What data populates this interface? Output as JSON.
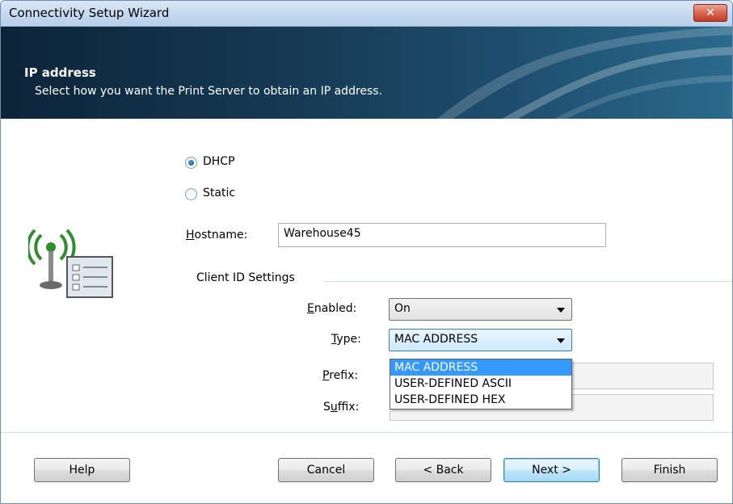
{
  "window": {
    "title": "Connectivity Setup Wizard",
    "close_glyph": "✕"
  },
  "banner": {
    "title": "IP address",
    "subtitle": "Select how you want the Print Server to obtain an IP address."
  },
  "form": {
    "radio_dhcp": {
      "label": "DHCP",
      "checked": true
    },
    "radio_static": {
      "label": "Static",
      "checked": false
    },
    "hostname": {
      "label_prefix": "H",
      "label_rest": "ostname:",
      "value": "Warehouse45"
    },
    "client_id_group": "Client ID Settings",
    "enabled": {
      "label_prefix": "E",
      "label_rest": "nabled:",
      "value": "On"
    },
    "type": {
      "label_prefix": "T",
      "label_rest": "ype:",
      "value": "MAC ADDRESS",
      "options": [
        "MAC ADDRESS",
        "USER-DEFINED ASCII",
        "USER-DEFINED HEX"
      ]
    },
    "prefix": {
      "label_prefix": "P",
      "label_rest": "refix:",
      "value": ""
    },
    "suffix": {
      "label_prefix": "S",
      "label_mid": "u",
      "label_rest": "ffix:",
      "value": ""
    }
  },
  "buttons": {
    "help": "Help",
    "cancel": "Cancel",
    "back": "< Back",
    "next": "Next >",
    "finish": "Finish"
  },
  "icons": {
    "wizard_icon": "wireless-network-settings-icon",
    "close": "close-icon",
    "dropdown_arrow": "chevron-down-icon"
  },
  "colors": {
    "banner_dark": "#0c2438",
    "selection": "#3399ff",
    "close_red": "#c23b22",
    "icon_green": "#2f8f2f"
  }
}
